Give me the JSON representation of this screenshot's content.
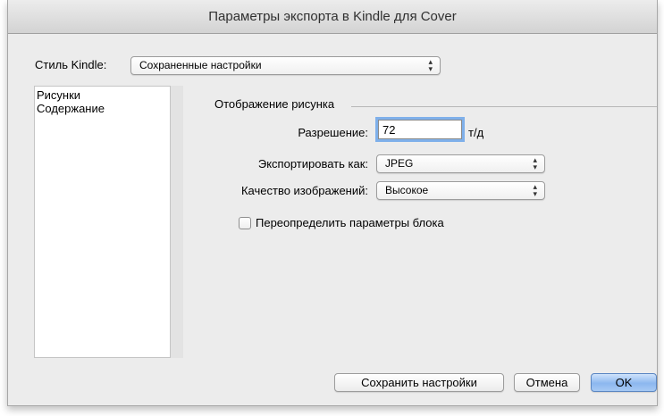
{
  "dialog": {
    "title": "Параметры экспорта в Kindle для Cover"
  },
  "kindle_style": {
    "label": "Стиль Kindle:",
    "selected": "Сохраненные настройки"
  },
  "sidebar": {
    "items": [
      {
        "label": "Рисунки"
      },
      {
        "label": "Содержание"
      }
    ]
  },
  "image_display": {
    "section_label": "Отображение рисунка",
    "resolution_label": "Разрешение:",
    "resolution_value": "72",
    "resolution_unit": "т/д",
    "export_as_label": "Экспортировать как:",
    "export_as_value": "JPEG",
    "quality_label": "Качество изображений:",
    "quality_value": "Высокое",
    "override_label": "Переопределить параметры блока",
    "override_checked": false
  },
  "buttons": {
    "save": "Сохранить настройки",
    "cancel": "Отмена",
    "ok": "OK"
  },
  "colors": {
    "focus_ring": "#7fb0ea",
    "default_button": "#8cb7ef"
  },
  "icons": {
    "popup_arrows": "up-down-arrows-icon"
  }
}
